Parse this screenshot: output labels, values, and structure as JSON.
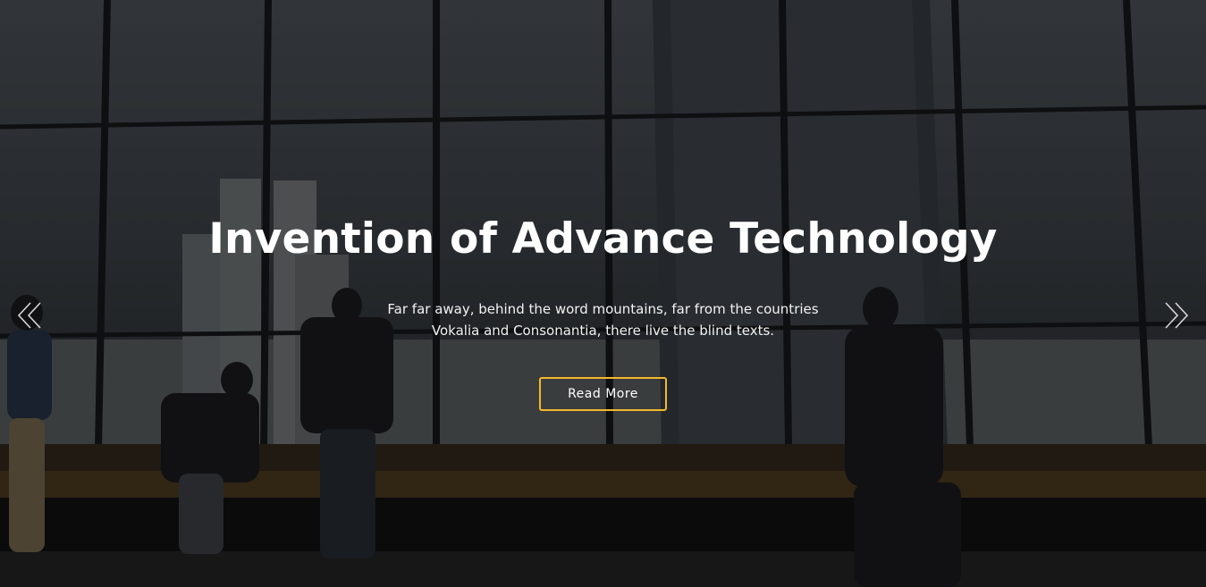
{
  "hero": {
    "title": "Invention of Advance Technology",
    "subtitle": "Far far away, behind the word mountains, far from the countries Vokalia and Consonantia, there live the blind texts.",
    "button_label": "Read More",
    "prev_icon": "double-chevron-left-icon",
    "next_icon": "double-chevron-right-icon",
    "accent_color": "#f4b82a"
  }
}
